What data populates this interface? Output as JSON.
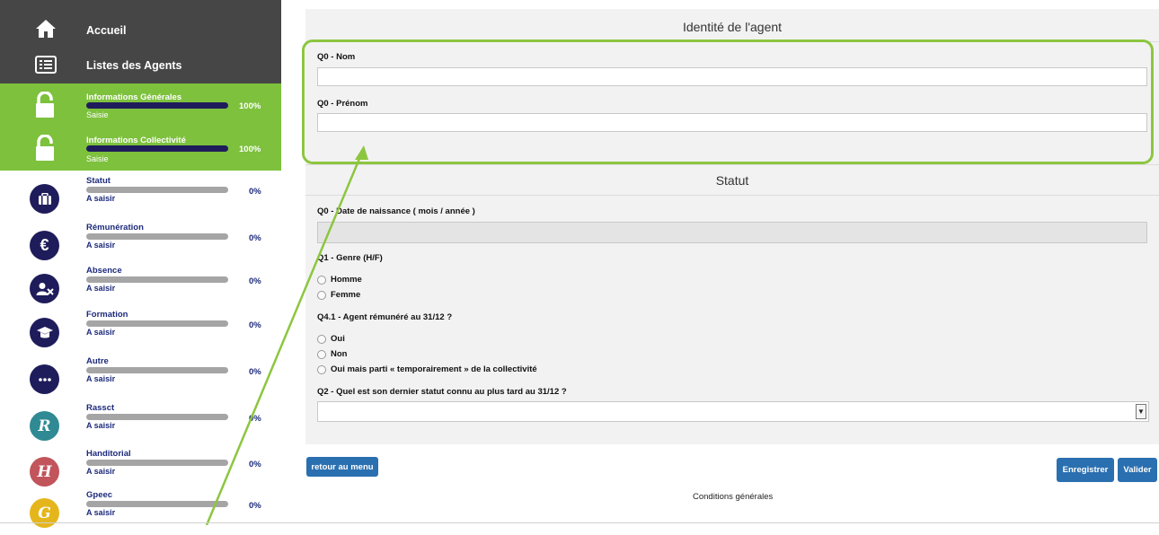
{
  "sidebar": {
    "top": [
      {
        "label": "Accueil",
        "icon": "home-icon"
      },
      {
        "label": "Listes des Agents",
        "icon": "list-icon"
      }
    ],
    "completed": [
      {
        "title": "Informations Générales",
        "status": "Saisie",
        "percent": "100%",
        "progress": 1.0
      },
      {
        "title": "Informations Collectivité",
        "status": "Saisie",
        "percent": "100%",
        "progress": 1.0
      }
    ],
    "items": [
      {
        "title": "Statut",
        "status": "A saisir",
        "percent": "0%",
        "progress": 0,
        "icon": "briefcase-icon",
        "color": "#1f1c5b"
      },
      {
        "title": "Rémunération",
        "status": "A saisir",
        "percent": "0%",
        "progress": 0,
        "icon": "euro-icon",
        "color": "#1f1c5b"
      },
      {
        "title": "Absence",
        "status": "A saisir",
        "percent": "0%",
        "progress": 0,
        "icon": "user-x-icon",
        "color": "#1f1c5b"
      },
      {
        "title": "Formation",
        "status": "A saisir",
        "percent": "0%",
        "progress": 0,
        "icon": "graduation-cap-icon",
        "color": "#1f1c5b"
      },
      {
        "title": "Autre",
        "status": "A saisir",
        "percent": "0%",
        "progress": 0,
        "icon": "more-icon",
        "color": "#1f1c5b"
      },
      {
        "title": "Rassct",
        "status": "A saisir",
        "percent": "0%",
        "progress": 0,
        "icon": "r-letter-icon",
        "letter": "R",
        "color": "#2f8a94"
      },
      {
        "title": "Handitorial",
        "status": "A saisir",
        "percent": "0%",
        "progress": 0,
        "icon": "h-letter-icon",
        "letter": "H",
        "color": "#c2545c"
      },
      {
        "title": "Gpeec",
        "status": "A saisir",
        "percent": "0%",
        "progress": 0,
        "icon": "g-letter-icon",
        "letter": "G",
        "color": "#e5b61c"
      }
    ]
  },
  "identity": {
    "title": "Identité de l'agent",
    "nom_label": "Q0 - Nom",
    "prenom_label": "Q0 - Prénom"
  },
  "statut": {
    "title": "Statut",
    "birth_label": "Q0 - Date de naissance ( mois / année )",
    "genre_label": "Q1 - Genre (H/F)",
    "genre_options": [
      "Homme",
      "Femme"
    ],
    "remunere_label": "Q4.1 - Agent rémunéré au 31/12 ?",
    "remunere_options": [
      "Oui",
      "Non",
      "Oui mais parti « temporairement » de la collectivité"
    ],
    "dernier_statut_label": "Q2 - Quel est son dernier statut connu au plus tard au 31/12 ?"
  },
  "buttons": {
    "retour": "retour au menu",
    "enregistrer": "Enregistrer",
    "valider": "Valider"
  },
  "footer": {
    "conditions": "Conditions générales"
  },
  "colors": {
    "green": "#7dc13d",
    "navy": "#1f1c5b",
    "button": "#2a6fb0",
    "highlight": "#8cc63f"
  }
}
